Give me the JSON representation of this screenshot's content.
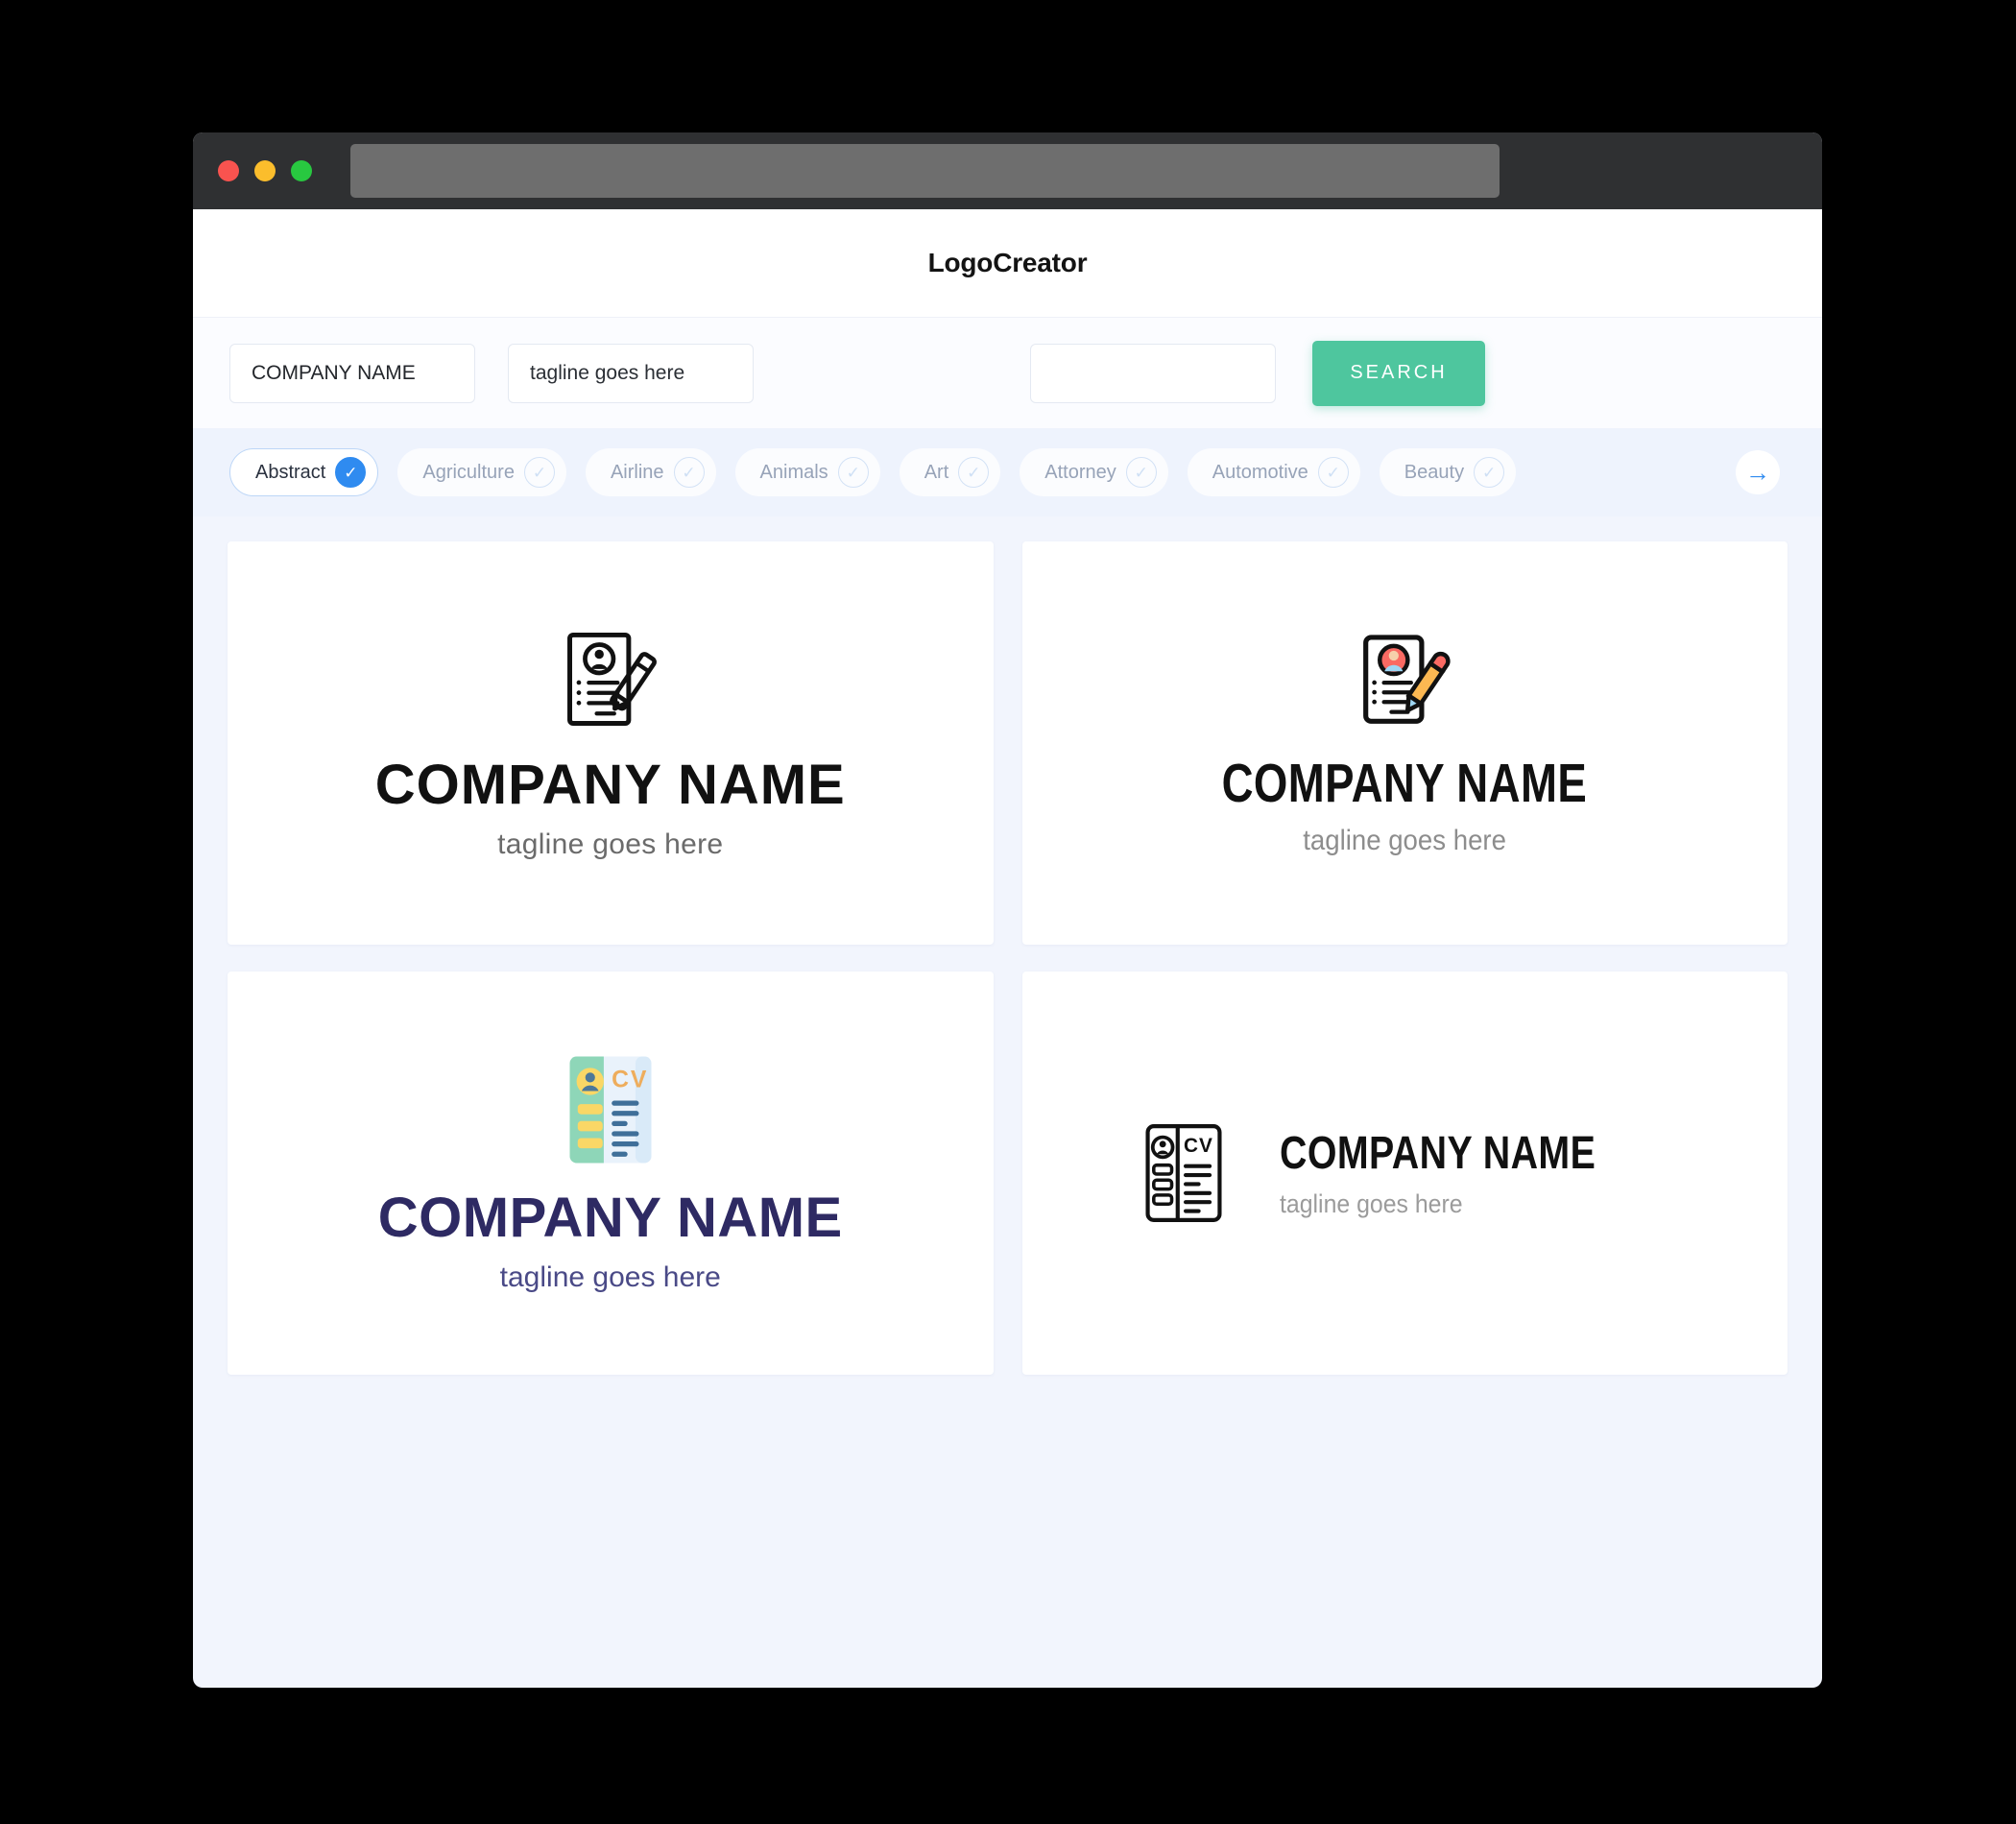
{
  "window": {
    "traffic_lights": [
      "close",
      "minimize",
      "maximize"
    ],
    "url_value": ""
  },
  "header": {
    "app_title": "LogoCreator"
  },
  "search": {
    "company_value": "COMPANY NAME",
    "company_placeholder": "COMPANY NAME",
    "tagline_value": "tagline goes here",
    "tagline_placeholder": "tagline goes here",
    "keyword_value": "",
    "keyword_placeholder": "",
    "search_label": "SEARCH"
  },
  "categories": {
    "next_icon": "arrow-right-icon",
    "items": [
      {
        "label": "Abstract",
        "selected": true,
        "icon": "check-icon"
      },
      {
        "label": "Agriculture",
        "selected": false,
        "icon": "check-icon"
      },
      {
        "label": "Airline",
        "selected": false,
        "icon": "check-icon"
      },
      {
        "label": "Animals",
        "selected": false,
        "icon": "check-icon"
      },
      {
        "label": "Art",
        "selected": false,
        "icon": "check-icon"
      },
      {
        "label": "Attorney",
        "selected": false,
        "icon": "check-icon"
      },
      {
        "label": "Automotive",
        "selected": false,
        "icon": "check-icon"
      },
      {
        "label": "Beauty",
        "selected": false,
        "icon": "check-icon"
      }
    ]
  },
  "results": [
    {
      "id": "logo-1",
      "icon": "resume-pencil-outline-icon",
      "layout": "vertical",
      "company": "COMPANY NAME",
      "tagline": "tagline goes here",
      "name_color": "#111111",
      "tagline_color": "#6b6b6b"
    },
    {
      "id": "logo-2",
      "icon": "resume-pencil-color-icon",
      "layout": "vertical",
      "company": "COMPANY NAME",
      "tagline": "tagline goes here",
      "name_color": "#111111",
      "tagline_color": "#8d8d8d"
    },
    {
      "id": "logo-3",
      "icon": "cv-card-flat-icon",
      "layout": "vertical",
      "company": "COMPANY NAME",
      "tagline": "tagline goes here",
      "name_color": "#2e2a63",
      "tagline_color": "#4a4a87"
    },
    {
      "id": "logo-4",
      "icon": "cv-card-outline-icon",
      "layout": "horizontal",
      "company": "COMPANY NAME",
      "tagline": "tagline goes here",
      "name_color": "#111111",
      "tagline_color": "#9b9b9b"
    }
  ],
  "colors": {
    "accent_green": "#4ec69e",
    "accent_blue": "#2f8bf0",
    "page_bg": "#f2f5fd",
    "chip_bar_bg": "#eef3fd",
    "titlebar_bg": "#2f3032",
    "navy": "#2e2a63",
    "flat_mint": "#8ed6b8",
    "flat_yellow": "#fad766",
    "flat_orange": "#eead5c",
    "flat_steel": "#3f6f99",
    "avatar_red": "#fa6a63",
    "avatar_skin": "#f6d0ab",
    "avatar_blue": "#9ed7f5",
    "pencil_body": "#fcb852"
  }
}
